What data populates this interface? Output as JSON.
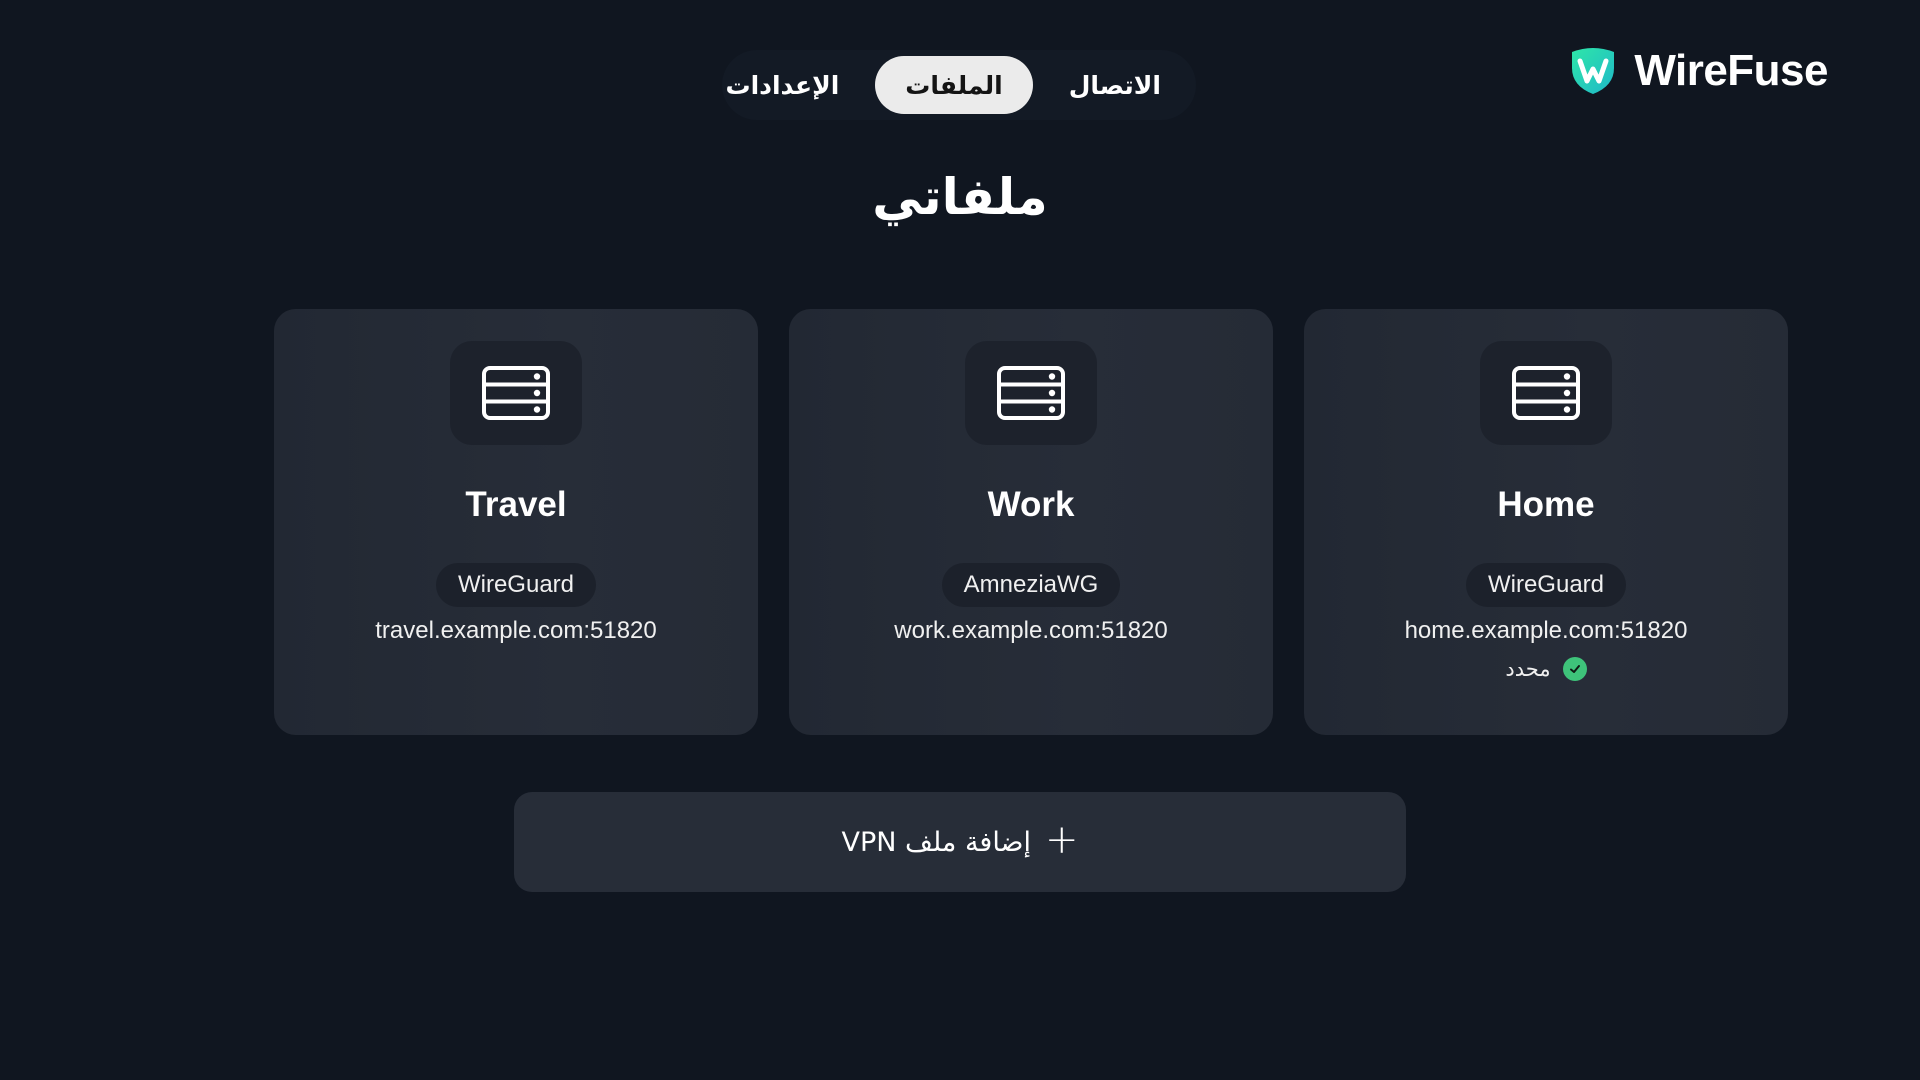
{
  "app": {
    "name": "WireFuse",
    "brand_gradient": [
      "#2ee6a8",
      "#1fb8c9"
    ]
  },
  "tabs": [
    {
      "label": "الاتصال",
      "active": false
    },
    {
      "label": "الملفات",
      "active": true
    },
    {
      "label": "الإعدادات",
      "active": false
    }
  ],
  "page": {
    "title": "ملفاتي"
  },
  "profiles": [
    {
      "name": "Home",
      "protocol": "WireGuard",
      "endpoint": "home.example.com:51820",
      "selected": true,
      "selected_label": "محدد",
      "icon": "server-icon"
    },
    {
      "name": "Work",
      "protocol": "AmneziaWG",
      "endpoint": "work.example.com:51820",
      "selected": false,
      "icon": "server-icon"
    },
    {
      "name": "Travel",
      "protocol": "WireGuard",
      "endpoint": "travel.example.com:51820",
      "selected": false,
      "icon": "server-icon"
    }
  ],
  "add_button": {
    "label": "إضافة ملف VPN",
    "icon": "plus-icon"
  },
  "colors": {
    "background": "#101620",
    "card": "#262c37",
    "active_tab": "#ebebeb",
    "selected_check": "#3ec37a"
  }
}
